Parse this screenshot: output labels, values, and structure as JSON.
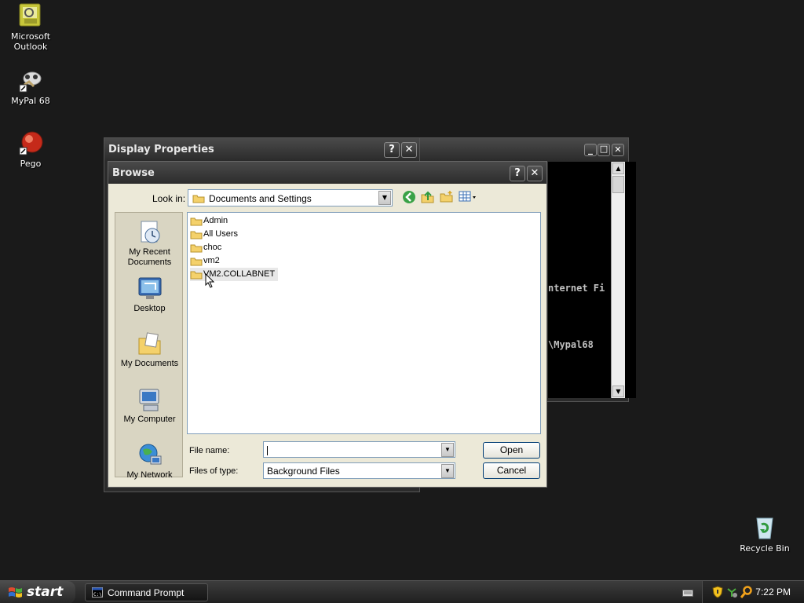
{
  "desktop": {
    "icons": [
      {
        "label_line1": "Microsoft",
        "label_line2": "Outlook"
      },
      {
        "label_line1": "MyPal 68",
        "label_line2": ""
      },
      {
        "label_line1": "Pego",
        "label_line2": ""
      },
      {
        "label_line1": "Recycle Bin",
        "label_line2": ""
      }
    ]
  },
  "cmd_window": {
    "lines": [
      "nternet Fi",
      "\\Mypal68"
    ]
  },
  "display_properties": {
    "title": "Display Properties",
    "help_glyph": "?",
    "close_glyph": "✕"
  },
  "browse_dialog": {
    "title": "Browse",
    "help_glyph": "?",
    "close_glyph": "✕",
    "look_in_label": "Look in:",
    "look_in_value": "Documents and Settings",
    "places": [
      {
        "line1": "My Recent",
        "line2": "Documents",
        "icon": "recent-documents-icon"
      },
      {
        "line1": "Desktop",
        "line2": "",
        "icon": "desktop-icon"
      },
      {
        "line1": "My Documents",
        "line2": "",
        "icon": "my-documents-icon"
      },
      {
        "line1": "My Computer",
        "line2": "",
        "icon": "my-computer-icon"
      },
      {
        "line1": "My Network",
        "line2": "",
        "icon": "my-network-icon"
      }
    ],
    "items": [
      "Admin",
      "All Users",
      "choc",
      "vm2",
      "VM2.COLLABNET"
    ],
    "file_name_label": "File name:",
    "file_name_value": "",
    "files_of_type_label": "Files of type:",
    "files_of_type_value": "Background Files",
    "open_label": "Open",
    "cancel_label": "Cancel"
  },
  "taskbar": {
    "start_label": "start",
    "task_label": "Command Prompt",
    "clock": "7:22 PM"
  },
  "colors": {
    "desktop_bg": "#1a1a1a",
    "dialog_bg": "#ece9d8",
    "title_bar": "#3a3a3a",
    "selection_hover": "#e8e8e8"
  }
}
